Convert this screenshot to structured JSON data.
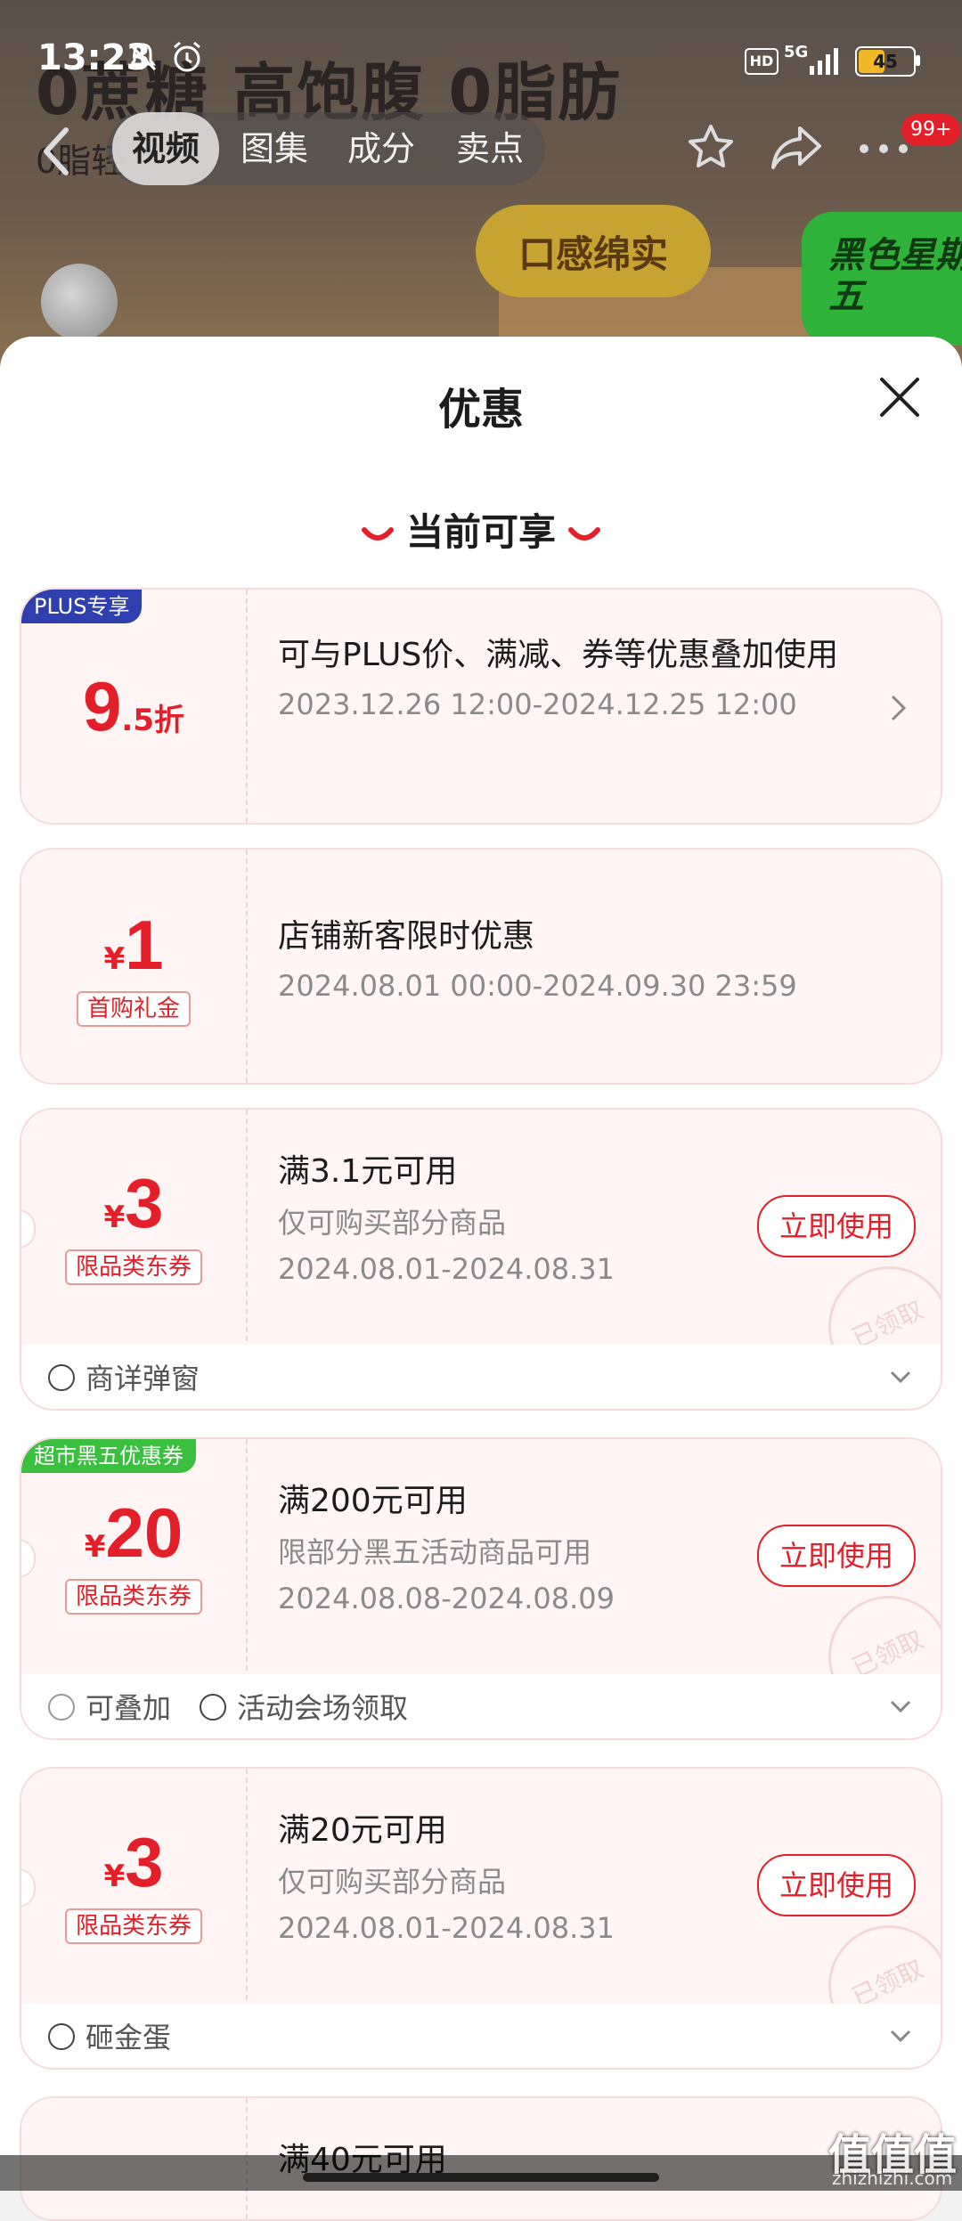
{
  "status_bar": {
    "time": "13:23",
    "network": "5G",
    "battery": "45",
    "battery_level": 0.45,
    "hd": "HD"
  },
  "background": {
    "headline": "0蔗糖 高饱腹 0脂肪",
    "subline": "0脂轻",
    "bubble": "口感绵实",
    "promo_badge": "黑色星期五"
  },
  "top_nav": {
    "tabs": [
      {
        "label": "视频",
        "active": true
      },
      {
        "label": "图集",
        "active": false
      },
      {
        "label": "成分",
        "active": false
      },
      {
        "label": "卖点",
        "active": false
      }
    ],
    "badge": "99+"
  },
  "sheet": {
    "title": "优惠",
    "section_title": "当前可享",
    "coupons": [
      {
        "corner_tag": "PLUS专享",
        "amount": "9",
        "amount_suffix": ".5折",
        "title": "可与PLUS价、满减、券等优惠叠加使用",
        "date": "2023.12.26 12:00-2024.12.25 12:00"
      },
      {
        "currency": "¥",
        "amount": "1",
        "label": "首购礼金",
        "title": "店铺新客限时优惠",
        "date": "2024.08.01 00:00-2024.09.30 23:59"
      },
      {
        "currency": "¥",
        "amount": "3",
        "label": "限品类东券",
        "title": "满3.1元可用",
        "subtitle": "仅可购买部分商品",
        "date": "2024.08.01-2024.08.31",
        "button": "立即使用",
        "stamp": "已领取",
        "footer": [
          "商详弹窗"
        ]
      },
      {
        "corner_tag": "超市黑五优惠券",
        "currency": "¥",
        "amount": "20",
        "label": "限品类东券",
        "title": "满200元可用",
        "subtitle": "限部分黑五活动商品可用",
        "date": "2024.08.08-2024.08.09",
        "button": "立即使用",
        "stamp": "已领取",
        "footer": [
          "可叠加",
          "活动会场领取"
        ]
      },
      {
        "currency": "¥",
        "amount": "3",
        "label": "限品类东券",
        "title": "满20元可用",
        "subtitle": "仅可购买部分商品",
        "date": "2024.08.01-2024.08.31",
        "button": "立即使用",
        "stamp": "已领取",
        "footer": [
          "砸金蛋"
        ]
      },
      {
        "title": "满40元可用"
      }
    ]
  },
  "watermark": {
    "logo": "值值值",
    "site": "zhizhizhi.com"
  },
  "colors": {
    "accent": "#e3202a",
    "plus_tag": "#2f3fae",
    "black_five_tag": "#3bbf3f",
    "card_bg": "#fff5f4"
  }
}
